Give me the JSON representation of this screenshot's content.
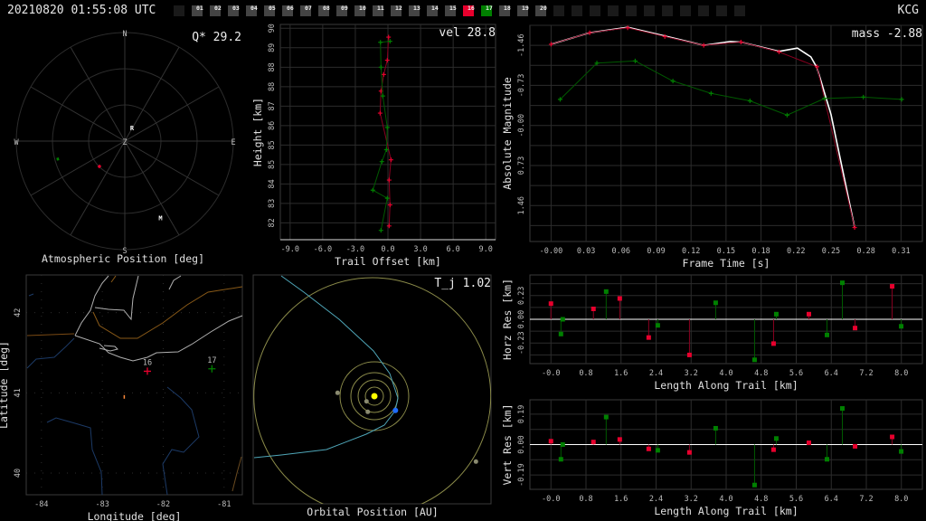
{
  "header": {
    "datetime": "20210820 01:55:08 UTC",
    "station_code": "KCG",
    "stations": [
      {
        "label": "",
        "status": "inactive"
      },
      {
        "label": "01",
        "status": "available"
      },
      {
        "label": "02",
        "status": "available"
      },
      {
        "label": "03",
        "status": "available"
      },
      {
        "label": "04",
        "status": "available"
      },
      {
        "label": "05",
        "status": "available"
      },
      {
        "label": "06",
        "status": "available"
      },
      {
        "label": "07",
        "status": "available"
      },
      {
        "label": "08",
        "status": "available"
      },
      {
        "label": "09",
        "status": "available"
      },
      {
        "label": "10",
        "status": "available"
      },
      {
        "label": "11",
        "status": "available"
      },
      {
        "label": "12",
        "status": "available"
      },
      {
        "label": "13",
        "status": "available"
      },
      {
        "label": "14",
        "status": "available"
      },
      {
        "label": "15",
        "status": "available"
      },
      {
        "label": "16",
        "status": "primary"
      },
      {
        "label": "17",
        "status": "secondary"
      },
      {
        "label": "18",
        "status": "available"
      },
      {
        "label": "19",
        "status": "available"
      },
      {
        "label": "20",
        "status": "available"
      },
      {
        "label": "",
        "status": "inactive"
      },
      {
        "label": "",
        "status": "inactive"
      },
      {
        "label": "",
        "status": "inactive"
      },
      {
        "label": "",
        "status": "inactive"
      },
      {
        "label": "",
        "status": "inactive"
      },
      {
        "label": "",
        "status": "inactive"
      },
      {
        "label": "",
        "status": "inactive"
      },
      {
        "label": "",
        "status": "inactive"
      },
      {
        "label": "",
        "status": "inactive"
      },
      {
        "label": "",
        "status": "inactive"
      },
      {
        "label": "",
        "status": "inactive"
      }
    ]
  },
  "colors": {
    "inactive": "#1a1a1a",
    "available": "#444444",
    "primary": "#e8002d",
    "secondary": "#008000",
    "fit": "#ffffff",
    "orbit": "#4fa6b8",
    "planet_orbit": "#8c8c4a",
    "sun": "#ffff00",
    "earth": "#1e6cff"
  },
  "chart_data": [
    {
      "id": "atmospheric",
      "type": "scatter",
      "projection": "polar-sky",
      "title": "Atmospheric Position [deg]",
      "annotation": "Q* 29.2",
      "cardinals": {
        "N": "N",
        "E": "E",
        "S": "S",
        "W": "W",
        "Z": "Z"
      },
      "rings_deg": [
        30,
        60,
        90
      ],
      "markers": [
        {
          "label": "R",
          "az": 28,
          "zd": 12.8
        },
        {
          "label": "M",
          "az": 155,
          "zd": 70
        }
      ],
      "series": [
        {
          "name": "16",
          "color": "primary",
          "az": 225,
          "zd": [
            28.5,
            31
          ]
        },
        {
          "name": "17",
          "color": "secondary",
          "az": 255,
          "zd": [
            56.5,
            58.5
          ]
        }
      ]
    },
    {
      "id": "trail",
      "type": "line",
      "xlabel": "Trail Offset [km]",
      "ylabel": "Height [km]",
      "annotation": "vel 28.8",
      "xlim": [
        -9.9,
        9.9
      ],
      "ylim": [
        81.75,
        90.05
      ],
      "xticks": [
        -9,
        -6,
        -3,
        0,
        3,
        6,
        9
      ],
      "xtick_labels": [
        "-9.0",
        "-6.0",
        "-3.0",
        "0.0",
        "3.0",
        "6.0",
        "9.0"
      ],
      "yticks": [
        89.9,
        89.15,
        88.4,
        87.65,
        86.9,
        86.15,
        85.4,
        84.65,
        83.9,
        83.15,
        82.4
      ],
      "ytick_labels": [
        "90",
        "89",
        "88",
        "88",
        "87",
        "86",
        "85",
        "85",
        "84",
        "83",
        "82"
      ],
      "series": [
        {
          "name": "16",
          "color": "primary",
          "x": [
            0.06,
            -0.06,
            -0.39,
            -0.64,
            -0.72,
            0.28,
            0.11,
            0.19,
            0.11
          ],
          "y": [
            89.56,
            88.67,
            88.12,
            87.48,
            86.63,
            84.83,
            84.05,
            83.09,
            82.28
          ]
        },
        {
          "name": "17",
          "color": "secondary",
          "x": [
            0.19,
            -0.69,
            -0.64,
            -0.47,
            -0.06,
            -0.14,
            -0.56,
            -1.39,
            -0.06,
            -0.64
          ],
          "y": [
            89.4,
            89.36,
            88.4,
            87.29,
            86.08,
            85.22,
            84.76,
            83.66,
            83.35,
            82.11
          ]
        }
      ]
    },
    {
      "id": "magnitude",
      "type": "line",
      "xlabel": "Frame Time [s]",
      "ylabel": "Absolute Magnitude",
      "annotation": "mass -2.88",
      "xlim": [
        -0.0189,
        0.3316
      ],
      "ylim": [
        -1.825,
        2.115
      ],
      "y_inverted": true,
      "xticks": [
        0,
        0.03125,
        0.0625,
        0.09375,
        0.125,
        0.15625,
        0.1875,
        0.21875,
        0.25,
        0.28125,
        0.3125
      ],
      "xtick_labels": [
        "-0.00",
        "0.03",
        "0.06",
        "0.09",
        "0.12",
        "0.15",
        "0.18",
        "0.22",
        "0.25",
        "0.28",
        "0.31"
      ],
      "yticks": [
        -1.825,
        -1.46,
        -1.095,
        -0.73,
        -0.365,
        0,
        0.365,
        0.73,
        1.095,
        1.46,
        1.825
      ],
      "ytick_labels": [
        "",
        "-1.46",
        "",
        "-0.73",
        "",
        "-0.00",
        "",
        "0.73",
        "",
        "1.46",
        ""
      ],
      "series": [
        {
          "name": "fit",
          "color": "fit",
          "x": [
            0,
            0.0345,
            0.0684,
            0.1016,
            0.1363,
            0.16,
            0.1696,
            0.2036,
            0.22,
            0.232,
            0.2375,
            0.25,
            0.2711
          ],
          "y": [
            -1.48,
            -1.69,
            -1.79,
            -1.63,
            -1.46,
            -1.53,
            -1.52,
            -1.35,
            -1.41,
            -1.25,
            -1.05,
            -0.2,
            1.86
          ],
          "markers": false
        },
        {
          "name": "16",
          "color": "primary",
          "x": [
            0,
            0.0345,
            0.0684,
            0.1016,
            0.1363,
            0.1696,
            0.2036,
            0.2375,
            0.2711
          ],
          "y": [
            -1.48,
            -1.69,
            -1.78,
            -1.62,
            -1.46,
            -1.52,
            -1.34,
            -1.07,
            1.86
          ],
          "markers": true
        },
        {
          "name": "17",
          "color": "secondary",
          "x": [
            0.0081,
            0.0409,
            0.0751,
            0.1088,
            0.1429,
            0.1776,
            0.2108,
            0.2442,
            0.2789,
            0.3131
          ],
          "y": [
            -0.475,
            -1.136,
            -1.175,
            -0.809,
            -0.585,
            -0.448,
            -0.189,
            -0.492,
            -0.516,
            -0.475
          ],
          "markers": true
        }
      ]
    },
    {
      "id": "map",
      "type": "scatter",
      "projection": "geographic",
      "xlabel": "Longitude [deg]",
      "ylabel": "Latitude [deg]",
      "xlim": [
        -84.25,
        -80.7
      ],
      "ylim": [
        39.73,
        42.47
      ],
      "xticks": [
        -84,
        -83,
        -82,
        -81
      ],
      "xtick_labels": [
        "-84",
        "-83",
        "-82",
        "-81"
      ],
      "yticks": [
        40,
        41,
        42
      ],
      "ytick_labels": [
        "40",
        "41",
        "42"
      ],
      "stations": [
        {
          "label": "16",
          "color": "primary",
          "lon": -82.26,
          "lat": 41.27
        },
        {
          "label": "17",
          "color": "secondary",
          "lon": -81.2,
          "lat": 41.3
        }
      ],
      "trail": {
        "lon": -82.64,
        "lat": 40.95
      }
    },
    {
      "id": "orbit",
      "type": "scatter",
      "projection": "orbital",
      "xlabel": "Orbital Position [AU]",
      "annotation": "T_j 1.02"
    },
    {
      "id": "horz_res",
      "type": "scatter",
      "xlabel": "Length Along Trail [km]",
      "ylabel": "Horz Res [km]",
      "xlim": [
        -0.48,
        8.48
      ],
      "ylim": [
        -0.43,
        0.43
      ],
      "xticks": [
        0,
        0.8,
        1.6,
        2.4,
        3.2,
        4.0,
        4.8,
        5.6,
        6.4,
        7.2,
        8.0
      ],
      "xtick_labels": [
        "-0.0",
        "0.8",
        "1.6",
        "2.4",
        "3.2",
        "4.0",
        "4.8",
        "5.6",
        "6.4",
        "7.2",
        "8.0"
      ],
      "yticks": [
        -0.345,
        -0.23,
        -0.115,
        0,
        0.115,
        0.23,
        0.345
      ],
      "ytick_labels": [
        "",
        "-0.23",
        "",
        "0.00",
        "",
        "0.23",
        ""
      ],
      "series": [
        {
          "name": "16",
          "color": "primary",
          "x": [
            0.0,
            0.97,
            1.571,
            2.232,
            3.162,
            5.083,
            5.889,
            6.943,
            7.79
          ],
          "y": [
            0.152,
            0.101,
            0.202,
            -0.177,
            -0.346,
            -0.236,
            0.05,
            -0.085,
            0.32
          ]
        },
        {
          "name": "17",
          "color": "secondary",
          "x": [
            0.228,
            0.269,
            1.261,
            2.439,
            3.761,
            4.649,
            5.145,
            6.302,
            6.653,
            7.996
          ],
          "y": [
            -0.143,
            0,
            0.269,
            -0.059,
            0.16,
            -0.393,
            0.05,
            -0.152,
            0.354,
            -0.068
          ]
        }
      ]
    },
    {
      "id": "vert_res",
      "type": "scatter",
      "xlabel": "Length Along Trail [km]",
      "ylabel": "Vert Res [km]",
      "xlim": [
        -0.48,
        8.48
      ],
      "ylim": [
        -0.28,
        0.28
      ],
      "xticks": [
        0,
        0.8,
        1.6,
        2.4,
        3.2,
        4.0,
        4.8,
        5.6,
        6.4,
        7.2,
        8.0
      ],
      "xtick_labels": [
        "-0.0",
        "0.8",
        "1.6",
        "2.4",
        "3.2",
        "4.0",
        "4.8",
        "5.6",
        "6.4",
        "7.2",
        "8.0"
      ],
      "yticks": [
        -0.19,
        -0.095,
        0,
        0.095,
        0.19
      ],
      "ytick_labels": [
        "-0.19",
        "",
        "0.00",
        "",
        "0.19"
      ],
      "series": [
        {
          "name": "16",
          "color": "primary",
          "x": [
            0.0,
            0.97,
            1.571,
            2.232,
            3.162,
            5.083,
            5.889,
            6.943,
            7.79
          ],
          "y": [
            0.021,
            0.016,
            0.032,
            -0.027,
            -0.049,
            -0.032,
            0.011,
            -0.011,
            0.048
          ]
        },
        {
          "name": "17",
          "color": "secondary",
          "x": [
            0.228,
            0.269,
            1.261,
            2.439,
            3.761,
            4.649,
            5.145,
            6.302,
            6.653,
            7.996
          ],
          "y": [
            -0.092,
            0,
            0.172,
            -0.036,
            0.102,
            -0.253,
            0.038,
            -0.092,
            0.226,
            -0.043
          ]
        }
      ]
    }
  ]
}
